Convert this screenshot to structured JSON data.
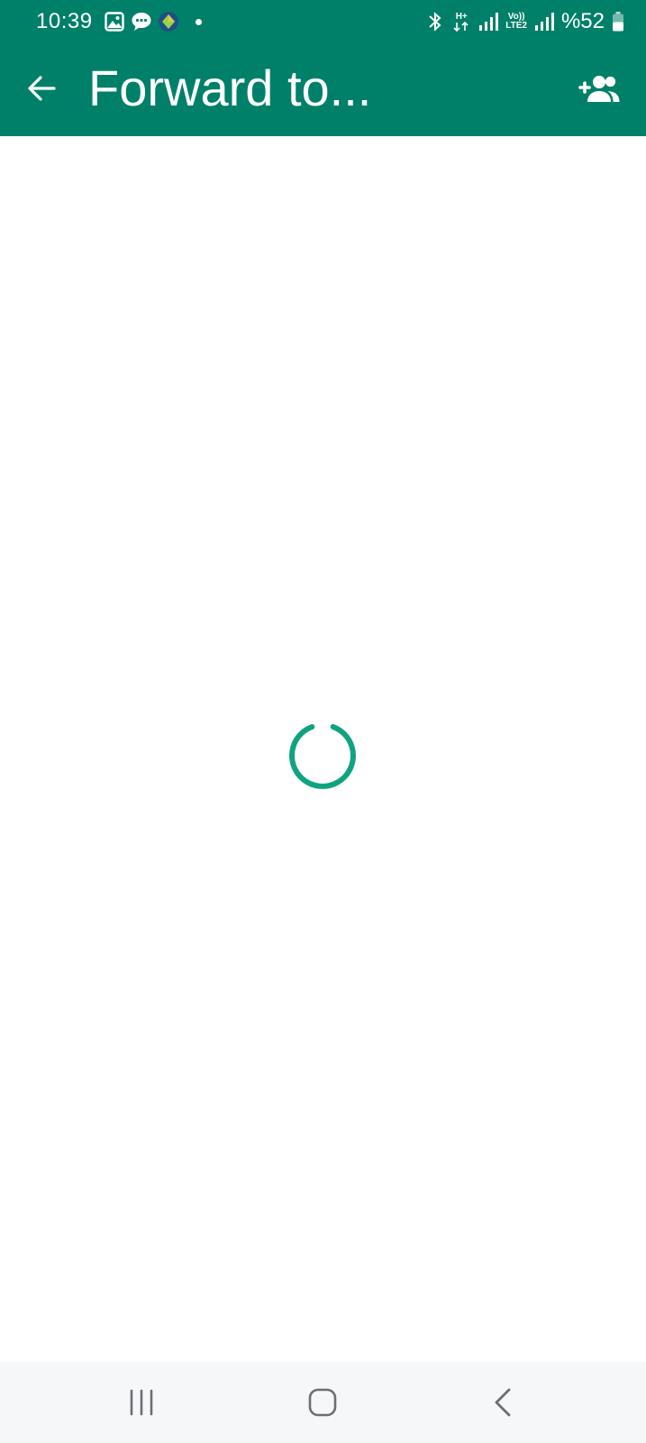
{
  "status_bar": {
    "time": "10:39",
    "network_type": "H+",
    "volte_label_top": "Vo))",
    "volte_label_bottom": "LTE2",
    "battery_text": "%52",
    "icons": [
      "gallery-icon",
      "message-bubble-icon",
      "app-badge-icon",
      "bluetooth-icon",
      "signal-icon",
      "battery-icon"
    ]
  },
  "app_bar": {
    "title": "Forward to...",
    "back_icon": "arrow-left-icon",
    "action_icon": "add-group-icon"
  },
  "content": {
    "loading_icon": "loading-spinner-icon"
  },
  "nav_bar": {
    "icons": [
      "recent-apps-icon",
      "home-icon",
      "back-icon"
    ]
  },
  "colors": {
    "brand": "#008069",
    "spinner": "#0fa37f",
    "nav_bg": "#f6f7f9",
    "nav_icon": "#6b6e73"
  }
}
